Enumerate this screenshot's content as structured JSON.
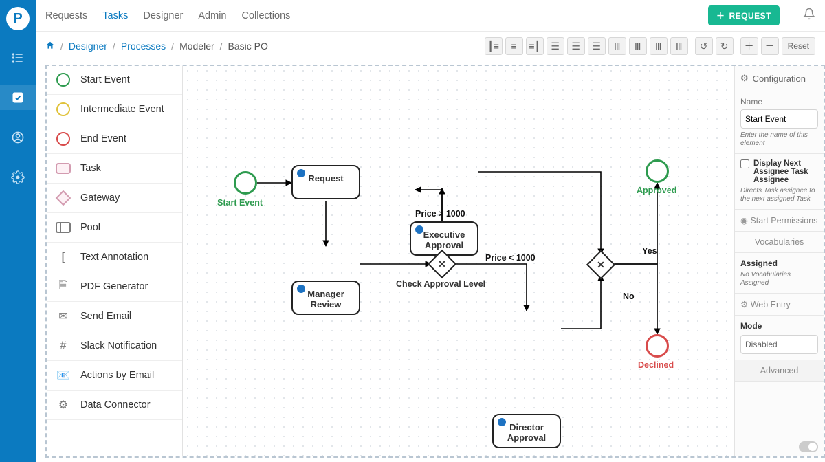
{
  "brand": {
    "letter": "P"
  },
  "nav": {
    "items": [
      "Requests",
      "Tasks",
      "Designer",
      "Admin",
      "Collections"
    ],
    "active_index": 1,
    "request_button": "REQUEST"
  },
  "breadcrumb": {
    "home_icon": "home",
    "items": [
      "Designer",
      "Processes",
      "Modeler",
      "Basic PO"
    ],
    "link_indices": [
      0,
      1
    ]
  },
  "toolbar": {
    "align": [
      "align-left",
      "align-center-h",
      "align-right",
      "align-top",
      "align-center-v",
      "align-bottom",
      "dist-h",
      "dist-v",
      "dist-h2",
      "dist-v2"
    ],
    "history": [
      "undo",
      "redo"
    ],
    "zoom": [
      "zoom-in",
      "zoom-out"
    ],
    "reset": "Reset"
  },
  "palette": [
    {
      "id": "start-event",
      "label": "Start Event",
      "icon": "circle-green"
    },
    {
      "id": "intermediate-event",
      "label": "Intermediate Event",
      "icon": "circle-yellow"
    },
    {
      "id": "end-event",
      "label": "End Event",
      "icon": "circle-red"
    },
    {
      "id": "task",
      "label": "Task",
      "icon": "task"
    },
    {
      "id": "gateway",
      "label": "Gateway",
      "icon": "gateway"
    },
    {
      "id": "pool",
      "label": "Pool",
      "icon": "pool"
    },
    {
      "id": "text-annotation",
      "label": "Text Annotation",
      "icon": "textann"
    },
    {
      "id": "pdf-generator",
      "label": "PDF Generator",
      "icon": "pdf"
    },
    {
      "id": "send-email",
      "label": "Send Email",
      "icon": "mail"
    },
    {
      "id": "slack-notification",
      "label": "Slack Notification",
      "icon": "slack"
    },
    {
      "id": "actions-by-email",
      "label": "Actions by Email",
      "icon": "mail2"
    },
    {
      "id": "data-connector",
      "label": "Data Connector",
      "icon": "gear"
    }
  ],
  "canvas": {
    "nodes": {
      "start": {
        "label": "Start Event"
      },
      "request": {
        "label": "Request"
      },
      "manager": {
        "label": "Manager Review"
      },
      "exec": {
        "label": "Executive Approval"
      },
      "gateway1": {
        "label": "Check Approval Level"
      },
      "director": {
        "label": "Director Approval"
      },
      "gateway2": {
        "label": ""
      },
      "approved": {
        "label": "Approved"
      },
      "declined": {
        "label": "Declined"
      }
    },
    "edge_labels": {
      "price_gt": "Price > 1000",
      "price_lt": "Price < 1000",
      "yes": "Yes",
      "no": "No"
    }
  },
  "config": {
    "title": "Configuration",
    "name_label": "Name",
    "name_value": "Start Event",
    "name_help": "Enter the name of this element",
    "checkbox_label": "Display Next Assignee Task Assignee",
    "checkbox_help": "Directs Task assignee to the next assigned Task",
    "start_permissions": "Start Permissions",
    "vocab_title": "Vocabularies",
    "assigned_label": "Assigned",
    "no_vocab": "No Vocabularies Assigned",
    "web_entry": "Web Entry",
    "mode_label": "Mode",
    "mode_value": "Disabled",
    "advanced": "Advanced"
  }
}
